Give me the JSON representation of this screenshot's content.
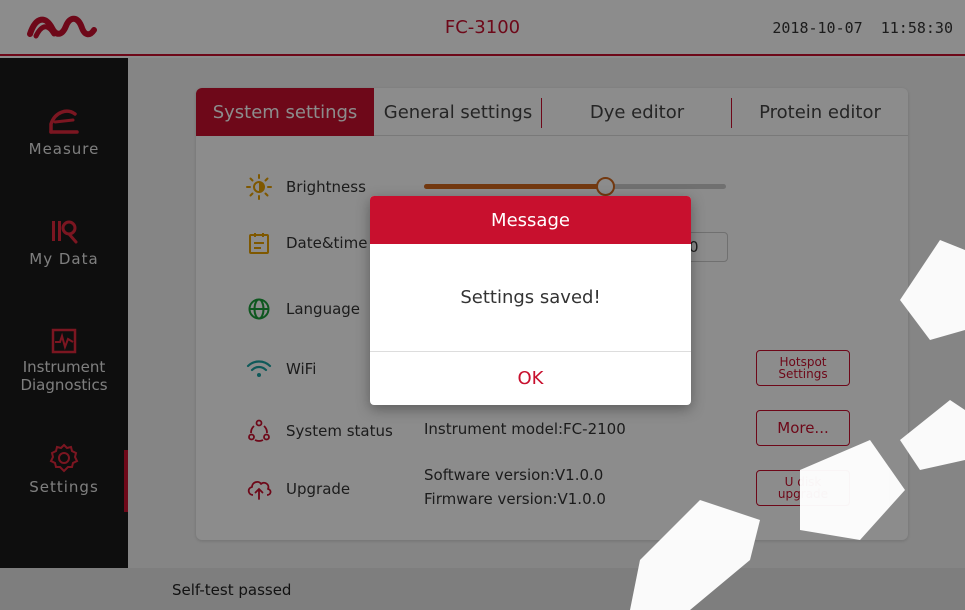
{
  "header": {
    "logo_icon": "brand-wave-logo",
    "title": "FC-3100",
    "datetime": "2018-10-07  11:58:30"
  },
  "sidebar": {
    "items": [
      {
        "label": "Measure",
        "icon": "measure-icon"
      },
      {
        "label": "My Data",
        "icon": "my-data-icon"
      },
      {
        "label": "Instrument Diagnostics",
        "label_line1": "Instrument",
        "label_line2": "Diagnostics",
        "icon": "diagnostics-icon"
      },
      {
        "label": "Settings",
        "icon": "gear-icon",
        "selected": true
      }
    ]
  },
  "tabs": [
    {
      "label": "System settings",
      "active": true
    },
    {
      "label": "General settings"
    },
    {
      "label": "Dye editor"
    },
    {
      "label": "Protein editor"
    }
  ],
  "settings": {
    "brightness": {
      "label": "Brightness",
      "value_percent": 60
    },
    "date": {
      "label": "Date&time",
      "value_fragment": "0"
    },
    "language": {
      "label": "Language"
    },
    "wifi": {
      "label": "WiFi",
      "hotspot_button": "Hotspot Settings",
      "hotspot_line1": "Hotspot",
      "hotspot_line2": "Settings"
    },
    "status": {
      "label": "System status",
      "value": "Instrument model:FC-2100",
      "more_button": "More..."
    },
    "upgrade": {
      "label": "Upgrade",
      "software": "Software version:V1.0.0",
      "firmware": "Firmware version:V1.0.0",
      "udisk_button": "U disk upgrade",
      "udisk_line1": "U disk",
      "udisk_line2": "upgrade"
    }
  },
  "dialog": {
    "title": "Message",
    "message": "Settings saved!",
    "ok_label": "OK"
  },
  "statusbar": {
    "text": "Self-test passed"
  },
  "colors": {
    "accent": "#c8102e",
    "slider": "#d2691e",
    "sidebar_bg": "#1a1a1a"
  }
}
